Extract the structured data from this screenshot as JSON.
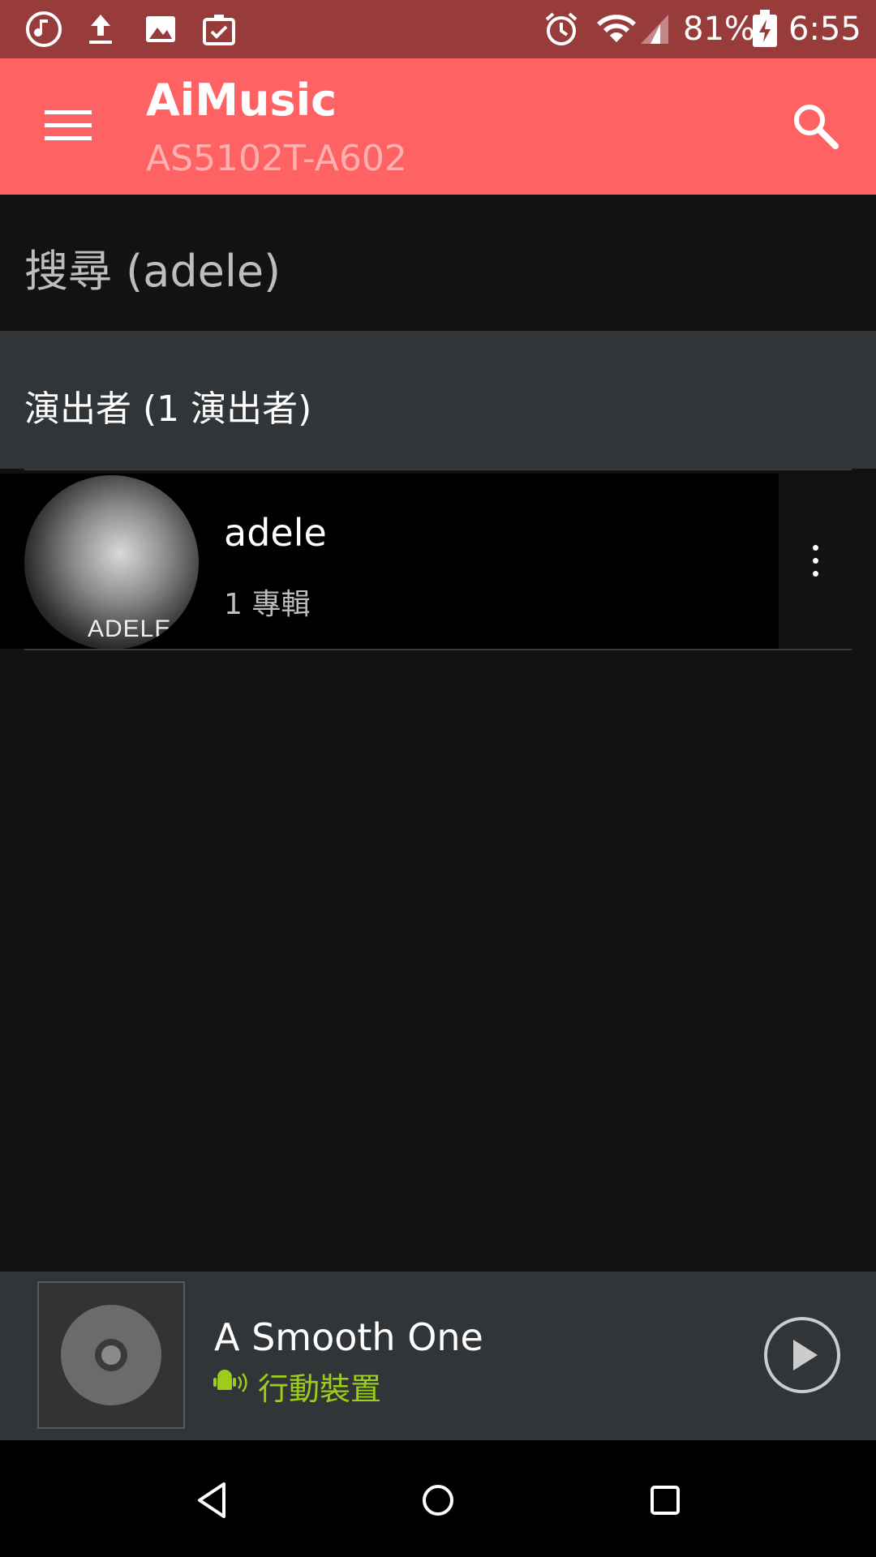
{
  "status_bar": {
    "battery": "81%",
    "time": "6:55",
    "icons": [
      "music-note-icon",
      "upload-icon",
      "image-icon",
      "clipboard-check-icon",
      "alarm-icon",
      "wifi-icon",
      "signal-icon",
      "battery-charging-icon"
    ]
  },
  "app_bar": {
    "title": "AiMusic",
    "subtitle": "AS5102T-A602",
    "menu_icon": "menu-icon",
    "search_icon": "search-icon",
    "color": "#fe6262"
  },
  "search": {
    "heading": "搜尋 (adele)"
  },
  "section": {
    "heading": "演出者 (1 演出者)"
  },
  "artists": [
    {
      "name": "adele",
      "subtitle": "1 專輯",
      "avatar_caption": "ADELE"
    }
  ],
  "now_playing": {
    "title": "A Smooth One",
    "device": "行動裝置",
    "device_color": "#9ccc1c"
  },
  "nav_bar": {
    "icons": [
      "back-icon",
      "home-icon",
      "recents-icon"
    ]
  }
}
